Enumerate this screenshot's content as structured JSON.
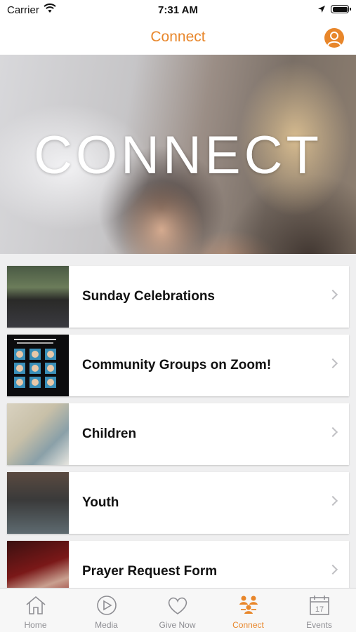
{
  "status_bar": {
    "carrier": "Carrier",
    "time": "7:31 AM"
  },
  "nav": {
    "title": "Connect"
  },
  "hero": {
    "text": "CONNECT"
  },
  "list": [
    {
      "label": "Sunday Celebrations"
    },
    {
      "label": "Community Groups on Zoom!"
    },
    {
      "label": "Children"
    },
    {
      "label": "Youth"
    },
    {
      "label": "Prayer Request Form"
    }
  ],
  "tabs": [
    {
      "label": "Home",
      "icon": "home-icon"
    },
    {
      "label": "Media",
      "icon": "play-icon"
    },
    {
      "label": "Give Now",
      "icon": "heart-icon"
    },
    {
      "label": "Connect",
      "icon": "people-icon",
      "active": true
    },
    {
      "label": "Events",
      "icon": "calendar-icon",
      "day": "17"
    }
  ],
  "colors": {
    "accent": "#e8862a",
    "inactive": "#8e8e93"
  }
}
